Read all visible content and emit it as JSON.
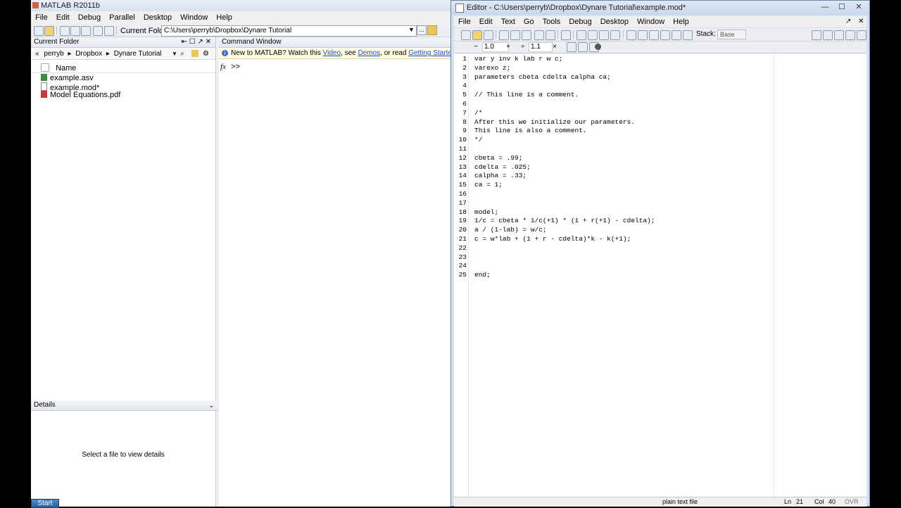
{
  "main": {
    "title": "MATLAB  R2011b",
    "menu": [
      "File",
      "Edit",
      "Debug",
      "Parallel",
      "Desktop",
      "Window",
      "Help"
    ],
    "current_folder_label": "Current Folder:",
    "current_folder_path": "C:\\Users\\perryb\\Dropbox\\Dynare Tutorial",
    "browse_label": "..."
  },
  "folder_panel": {
    "title": "Current Folder",
    "breadcrumb": [
      "perryb",
      "Dropbox",
      "Dynare Tutorial"
    ],
    "column_name": "Name",
    "files": [
      {
        "name": "example.asv",
        "icon": "asv-file-icon"
      },
      {
        "name": "example.mod*",
        "icon": "mod-file-icon"
      },
      {
        "name": "Model Equations.pdf",
        "icon": "pdf-file-icon"
      }
    ],
    "details_title": "Details",
    "details_message": "Select a file to view details"
  },
  "command": {
    "title": "Command Window",
    "msg_prefix": "New to MATLAB? Watch this ",
    "link_video": "Video",
    "msg_mid": ", see ",
    "link_demos": "Demos",
    "msg_or": ", or read ",
    "link_started": "Getting Started",
    "msg_end": ".",
    "fx": "fx",
    "prompt": ">>"
  },
  "taskbar": {
    "start": "Start"
  },
  "editor": {
    "title": "Editor - C:\\Users\\perryb\\Dropbox\\Dynare Tutorial\\example.mod*",
    "menu": [
      "File",
      "Edit",
      "Text",
      "Go",
      "Tools",
      "Debug",
      "Desktop",
      "Window",
      "Help"
    ],
    "stack_label": "Stack:",
    "stack_value": "Base",
    "cell_minus": "−",
    "cell_value1": "1.0",
    "cell_plus": "+",
    "cell_div": "÷",
    "cell_value2": "1.1",
    "cell_times": "×",
    "lines": [
      "var y inv k lab r w c;",
      "varexo z;",
      "parameters cbeta cdelta calpha ca;",
      "",
      "// This line is a comment.",
      "",
      "/*",
      "After this we initialize our parameters.",
      "This line is also a comment.",
      "*/",
      "",
      "cbeta = .99;",
      "cdelta = .025;",
      "calpha = .33;",
      "ca = 1;",
      "",
      "",
      "model;",
      "1/c = cbeta * 1/c(+1) * (1 + r(+1) - cdelta);",
      "a / (1-lab) = w/c;",
      "c = w*lab + (1 + r - cdelta)*k - k(+1);",
      "",
      "",
      "",
      "end;"
    ],
    "status": {
      "file_type": "plain text file",
      "ln_label": "Ln",
      "ln_value": "21",
      "col_label": "Col",
      "col_value": "40",
      "ovr": "OVR"
    }
  },
  "colors": {
    "title_bar": "#d8e2ef",
    "link": "#1b55c8",
    "message_bg": "#fffbe0"
  }
}
